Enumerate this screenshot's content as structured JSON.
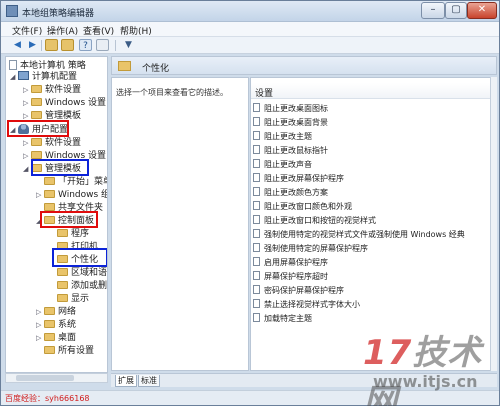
{
  "window": {
    "title": "本地组策略编辑器",
    "controls": {
      "minimize": "–",
      "maximize": "▢",
      "close": "✕"
    }
  },
  "menubar": {
    "items": [
      "文件(F)",
      "操作(A)",
      "查看(V)",
      "帮助(H)"
    ]
  },
  "toolbar": {
    "icons": [
      "back-arrow-icon",
      "forward-arrow-icon",
      "up-folder-icon",
      "show-hide-tree-icon",
      "help-icon",
      "properties-icon",
      "filter-icon"
    ],
    "glyphs": {
      "back": "◀",
      "forward": "▶",
      "help": "?",
      "filter": "▼"
    }
  },
  "tree": {
    "root": "本地计算机 策略",
    "computer_config": "计算机配置",
    "cc_children": [
      "软件设置",
      "Windows 设置",
      "管理模板"
    ],
    "user_config": "用户配置",
    "uc_children": [
      "软件设置",
      "Windows 设置",
      "管理模板"
    ],
    "admin_templates_children": [
      "「开始」菜单",
      "Windows 组",
      "共享文件夹",
      "控制面板"
    ],
    "control_panel_children": [
      "程序",
      "打印机",
      "个性化",
      "区域和语",
      "添加或删除",
      "显示"
    ],
    "after_control_panel": [
      "网络",
      "系统",
      "桌面",
      "所有设置"
    ]
  },
  "right_header": {
    "title": "个性化"
  },
  "description": {
    "text": "选择一个项目来查看它的描述。"
  },
  "list": {
    "column_header": "设置",
    "rows": [
      "阻止更改桌面图标",
      "阻止更改桌面背景",
      "阻止更改主题",
      "阻止更改鼠标指针",
      "阻止更改声音",
      "阻止更改屏幕保护程序",
      "阻止更改颜色方案",
      "阻止更改窗口颜色和外观",
      "阻止更改窗口和按钮的视觉样式",
      "强制使用特定的视觉样式文件或强制使用 Windows 经典",
      "强制使用特定的屏幕保护程序",
      "启用屏幕保护程序",
      "屏幕保护程序超时",
      "密码保护屏幕保护程序",
      "禁止选择视觉样式字体大小",
      "加载特定主题"
    ]
  },
  "tabs": [
    "扩展",
    "标准"
  ],
  "watermark": {
    "logo_num": "17",
    "logo_text": "技术网",
    "url": "www.itjs.cn"
  },
  "credit": "百度经验：syh666168",
  "highlight_colors": {
    "red": "#e00c0c",
    "blue": "#0c23d8"
  }
}
